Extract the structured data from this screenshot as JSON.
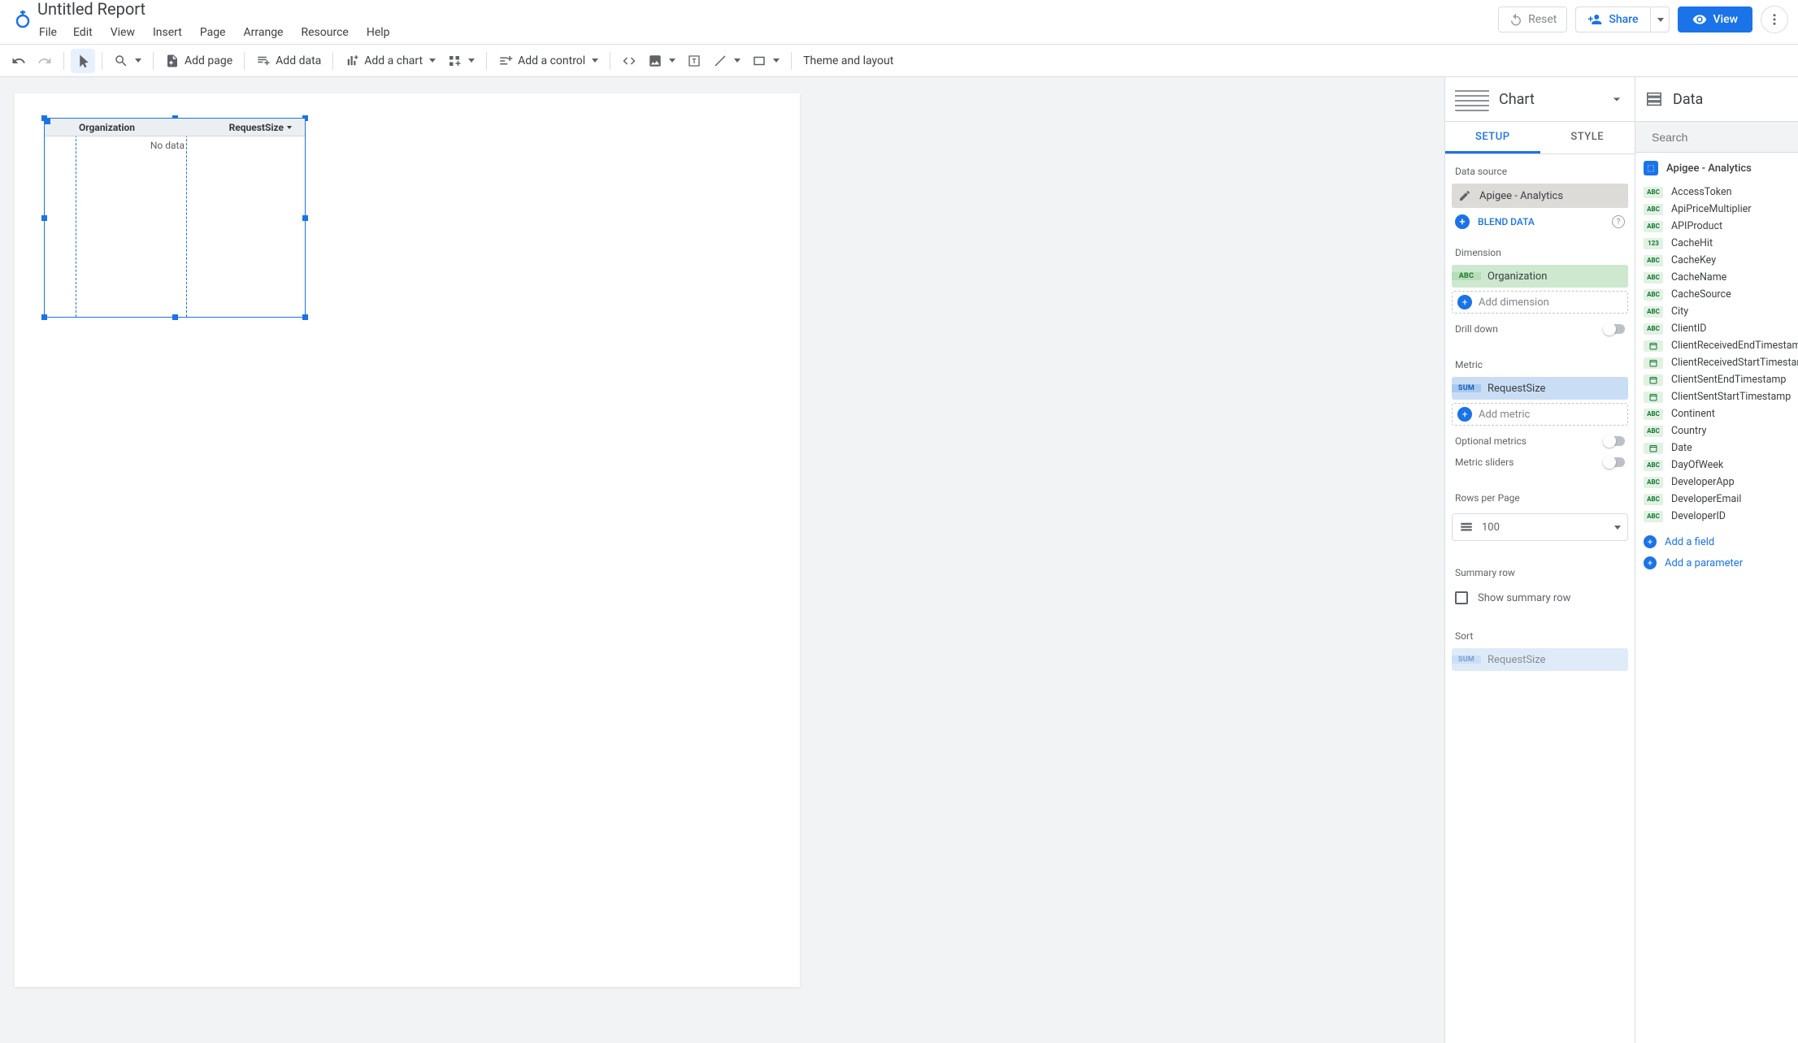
{
  "app": {
    "title": "Untitled Report"
  },
  "menubar": [
    "File",
    "Edit",
    "View",
    "Insert",
    "Page",
    "Arrange",
    "Resource",
    "Help"
  ],
  "header_actions": {
    "reset": "Reset",
    "share": "Share",
    "view": "View"
  },
  "toolbar": {
    "add_page": "Add page",
    "add_data": "Add data",
    "add_chart": "Add a chart",
    "add_control": "Add a control",
    "theme_layout": "Theme and layout"
  },
  "canvas_table": {
    "columns": [
      "Organization",
      "RequestSize"
    ],
    "no_data": "No data"
  },
  "panel_chart": {
    "title": "Chart",
    "tabs": {
      "setup": "SETUP",
      "style": "STYLE"
    },
    "data_source_label": "Data source",
    "data_source_value": "Apigee - Analytics",
    "blend": "BLEND DATA",
    "dimension_label": "Dimension",
    "dimension_chip": {
      "type": "ABC",
      "name": "Organization"
    },
    "add_dimension": "Add dimension",
    "drill_down": "Drill down",
    "metric_label": "Metric",
    "metric_chip": {
      "type": "SUM",
      "name": "RequestSize"
    },
    "add_metric": "Add metric",
    "optional_metrics": "Optional metrics",
    "metric_sliders": "Metric sliders",
    "rows_per_page_label": "Rows per Page",
    "rows_per_page_value": "100",
    "summary_row_label": "Summary row",
    "show_summary_row": "Show summary row",
    "sort_label": "Sort",
    "sort_chip": {
      "type": "SUM",
      "name": "RequestSize"
    }
  },
  "panel_data": {
    "title": "Data",
    "search_placeholder": "Search",
    "source_name": "Apigee - Analytics",
    "fields": [
      {
        "type": "ABC",
        "name": "AccessToken"
      },
      {
        "type": "ABC",
        "name": "ApiPriceMultiplier"
      },
      {
        "type": "ABC",
        "name": "APIProduct"
      },
      {
        "type": "123",
        "name": "CacheHit"
      },
      {
        "type": "ABC",
        "name": "CacheKey"
      },
      {
        "type": "ABC",
        "name": "CacheName"
      },
      {
        "type": "ABC",
        "name": "CacheSource"
      },
      {
        "type": "ABC",
        "name": "City"
      },
      {
        "type": "ABC",
        "name": "ClientID"
      },
      {
        "type": "DATE",
        "name": "ClientReceivedEndTimestamp"
      },
      {
        "type": "DATE",
        "name": "ClientReceivedStartTimestamp"
      },
      {
        "type": "DATE",
        "name": "ClientSentEndTimestamp"
      },
      {
        "type": "DATE",
        "name": "ClientSentStartTimestamp"
      },
      {
        "type": "ABC",
        "name": "Continent"
      },
      {
        "type": "ABC",
        "name": "Country"
      },
      {
        "type": "DATE",
        "name": "Date"
      },
      {
        "type": "ABC",
        "name": "DayOfWeek"
      },
      {
        "type": "ABC",
        "name": "DeveloperApp"
      },
      {
        "type": "ABC",
        "name": "DeveloperEmail"
      },
      {
        "type": "ABC",
        "name": "DeveloperID"
      }
    ],
    "add_field": "Add a field",
    "add_parameter": "Add a parameter"
  }
}
